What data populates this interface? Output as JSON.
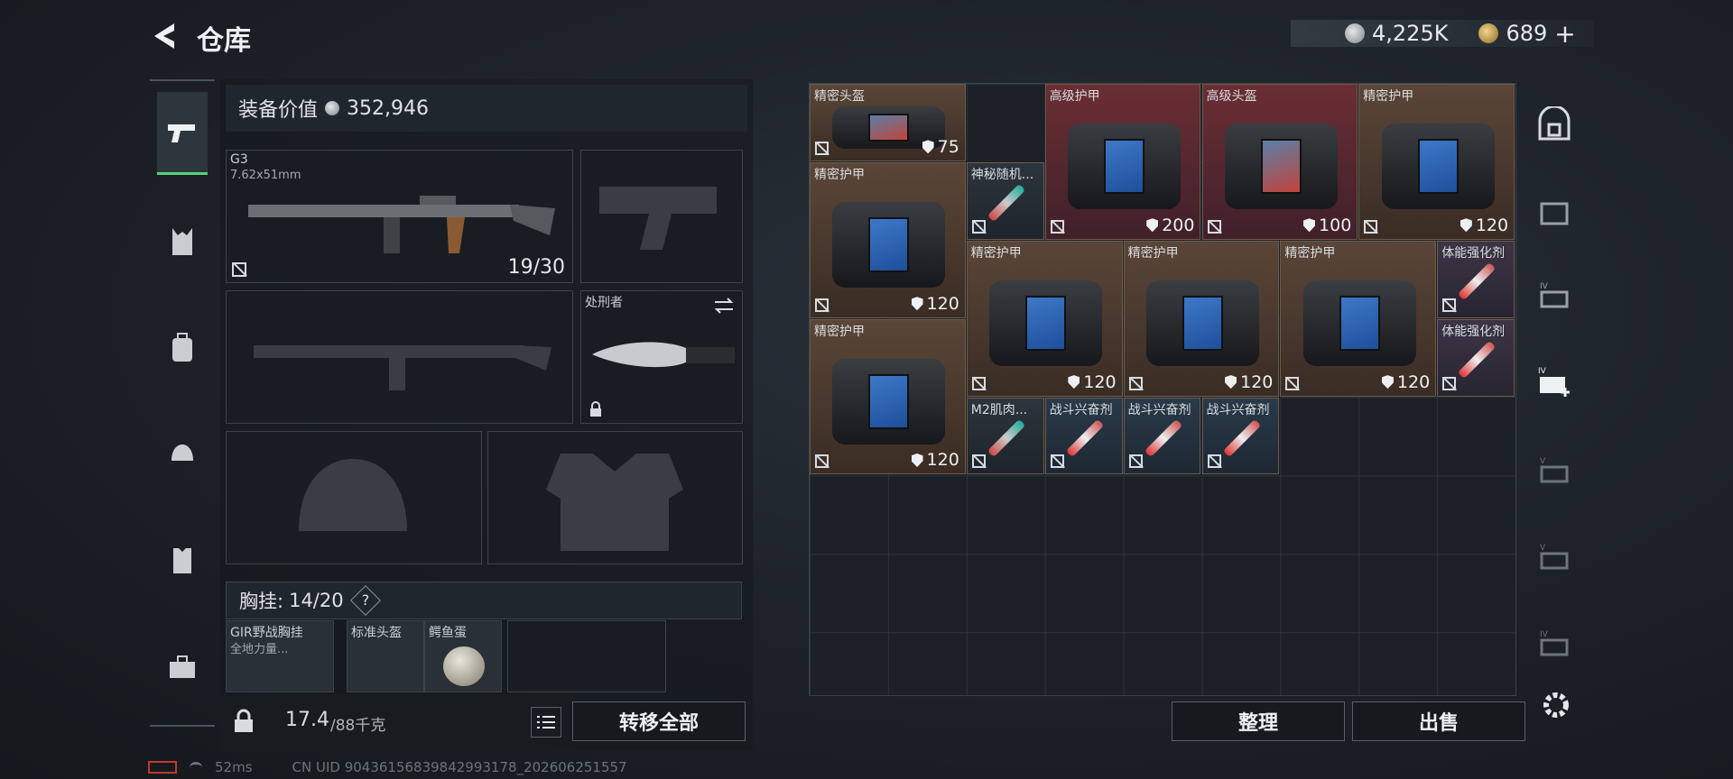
{
  "header": {
    "title": "仓库",
    "currency": {
      "silver": "4,225K",
      "gold": "689",
      "gold_plus": "+"
    }
  },
  "equipment": {
    "value_label": "装备价值",
    "value": "352,946",
    "primary": {
      "name": "G3",
      "caliber": "7.62x51mm",
      "ammo": "19/30"
    },
    "melee": {
      "name": "处刑者"
    },
    "chest": {
      "label": "胸挂:",
      "capacity": "14/20",
      "help": "?"
    },
    "chest_items": [
      "GIR野战胸挂",
      "全地力量...",
      "标准头盔",
      "鳄鱼蛋"
    ],
    "weight": {
      "current": "17.4",
      "max": "/88千克"
    },
    "transfer_all": "转移全部"
  },
  "stash": {
    "items": [
      {
        "name": "精密头盔",
        "dur": "75",
        "rarity": "brown"
      },
      {
        "name": "高级护甲",
        "dur": "200",
        "rarity": "red"
      },
      {
        "name": "高级头盔",
        "dur": "100",
        "rarity": "red"
      },
      {
        "name": "精密护甲",
        "dur": "120",
        "rarity": "brown"
      },
      {
        "name": "精密护甲",
        "dur": "120",
        "rarity": "brown"
      },
      {
        "name": "神秘随机...",
        "dur": "",
        "rarity": "gray"
      },
      {
        "name": "精密护甲",
        "dur": "120",
        "rarity": "brown"
      },
      {
        "name": "精密护甲",
        "dur": "120",
        "rarity": "brown"
      },
      {
        "name": "精密护甲",
        "dur": "120",
        "rarity": "brown"
      },
      {
        "name": "体能强化剂",
        "dur": "",
        "rarity": "purple"
      },
      {
        "name": "体能强化剂",
        "dur": "",
        "rarity": "purple"
      },
      {
        "name": "精密护甲",
        "dur": "120",
        "rarity": "brown"
      },
      {
        "name": "M2肌肉...",
        "dur": "",
        "rarity": "gray"
      },
      {
        "name": "战斗兴奋剂",
        "dur": "",
        "rarity": "blue"
      },
      {
        "name": "战斗兴奋剂",
        "dur": "",
        "rarity": "blue"
      },
      {
        "name": "战斗兴奋剂",
        "dur": "",
        "rarity": "blue"
      }
    ],
    "sort": "整理",
    "sell": "出售"
  },
  "rail": {
    "icons": [
      "safe-icon",
      "crate-icon",
      "case-iv-icon",
      "case-iv-add-icon",
      "case-v-icon",
      "case-v2-icon",
      "case-iv-3-icon",
      "settings-icon"
    ]
  },
  "status": {
    "ping": "52ms",
    "uid": "CN UID 9043615683984299317​8_202606251557"
  }
}
